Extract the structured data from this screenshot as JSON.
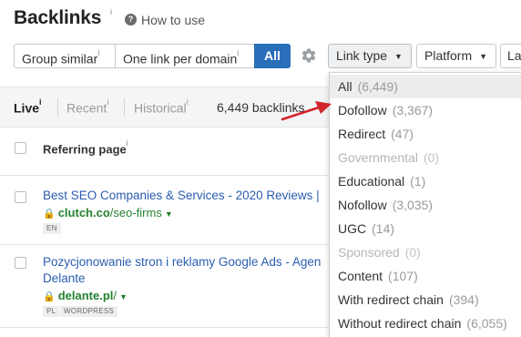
{
  "header": {
    "title": "Backlinks",
    "title_info": "i",
    "howto_icon_glyph": "?",
    "howto_label": "How to use"
  },
  "toolbar": {
    "group_similar": "Group similar",
    "group_similar_info": "i",
    "one_link": "One link per domain",
    "one_link_info": "i",
    "all": "All",
    "link_type": "Link type",
    "platform": "Platform",
    "more": "La"
  },
  "tabs": {
    "live": "Live",
    "recent": "Recent",
    "historical": "Historical",
    "info": "i",
    "count": "6,449 backlinks"
  },
  "table": {
    "header": "Referring page",
    "header_info": "i",
    "rows": [
      {
        "title": "Best SEO Companies & Services - 2020 Reviews |",
        "domain_bold": "clutch.co",
        "domain_path": "/seo-firms",
        "tags": [
          "EN"
        ]
      },
      {
        "title_line1": "Pozycjonowanie stron i reklamy Google Ads - Agen",
        "title_line2": "Delante",
        "domain_bold": "delante.pl",
        "domain_path": "/",
        "tags": [
          "PL",
          "WORDPRESS"
        ]
      }
    ]
  },
  "link_type_menu": {
    "items": [
      {
        "label": "All",
        "count": "(6,449)",
        "state": "selected"
      },
      {
        "label": "Dofollow",
        "count": "(3,367)",
        "state": "normal"
      },
      {
        "label": "Redirect",
        "count": "(47)",
        "state": "normal"
      },
      {
        "label": "Governmental",
        "count": "(0)",
        "state": "disabled"
      },
      {
        "label": "Educational",
        "count": "(1)",
        "state": "normal"
      },
      {
        "label": "Nofollow",
        "count": "(3,035)",
        "state": "normal"
      },
      {
        "label": "UGC",
        "count": "(14)",
        "state": "normal"
      },
      {
        "label": "Sponsored",
        "count": "(0)",
        "state": "disabled"
      },
      {
        "label": "Content",
        "count": "(107)",
        "state": "normal"
      },
      {
        "label": "With redirect chain",
        "count": "(394)",
        "state": "normal"
      },
      {
        "label": "Without redirect chain",
        "count": "(6,055)",
        "state": "normal"
      }
    ]
  },
  "colors": {
    "accent": "#2a6db8",
    "link": "#2a5db0",
    "domain": "#24822f",
    "annotation_arrow": "#d0262b"
  }
}
